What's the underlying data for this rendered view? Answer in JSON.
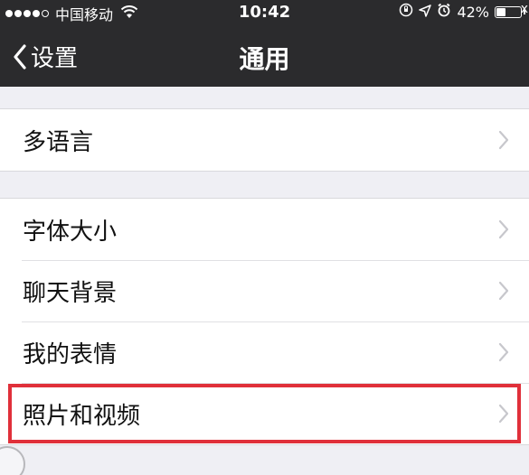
{
  "status_bar": {
    "carrier": "中国移动",
    "time": "10:42",
    "battery_percent": "42%",
    "battery_level": 0.42,
    "icons": [
      "signal-dots-icon",
      "wifi-icon",
      "rotation-lock-icon",
      "location-arrow-icon",
      "alarm-icon",
      "battery-icon"
    ]
  },
  "navbar": {
    "back_label": "设置",
    "title": "通用"
  },
  "groups": [
    {
      "items": [
        {
          "label": "多语言"
        }
      ]
    },
    {
      "items": [
        {
          "label": "字体大小"
        },
        {
          "label": "聊天背景"
        },
        {
          "label": "我的表情"
        },
        {
          "label": "照片和视频"
        }
      ]
    }
  ],
  "highlight": {
    "target": "照片和视频",
    "color": "#e0303a"
  },
  "colors": {
    "navbar_bg": "#2b2b2d",
    "page_bg": "#efeff4",
    "cell_bg": "#ffffff",
    "chevron": "#c7c7cc"
  }
}
